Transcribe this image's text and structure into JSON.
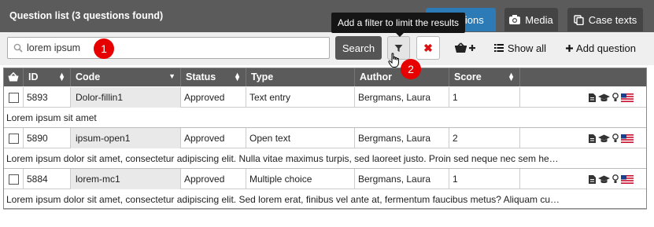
{
  "header": {
    "title": "Question list  (3 questions found)",
    "tabs": [
      {
        "label": "Questions",
        "icon": "list-icon"
      },
      {
        "label": "Media",
        "icon": "camera-icon"
      },
      {
        "label": "Case texts",
        "icon": "copy-icon"
      }
    ],
    "tooltip": "Add a filter to limit the results"
  },
  "toolbar": {
    "search_value": "lorem ipsum",
    "search_label": "Search",
    "clear_label": "✖",
    "basket_label": "🧺+",
    "show_all_label": "Show all",
    "add_question_label": "Add question"
  },
  "callouts": [
    "1",
    "2"
  ],
  "table": {
    "headers": [
      "ID",
      "Code",
      "Status",
      "Type",
      "Author",
      "Score"
    ],
    "rows": [
      {
        "id": "5893",
        "code": "Dolor-fillin1",
        "status": "Approved",
        "type": "Text entry",
        "author": "Bergmans, Laura",
        "score": "1",
        "description": "Lorem ipsum sit amet"
      },
      {
        "id": "5890",
        "code": "ipsum-open1",
        "status": "Approved",
        "type": "Open text",
        "author": "Bergmans, Laura",
        "score": "2",
        "description": "Lorem ipsum dolor sit amet, consectetur adipiscing elit. Nulla vitae maximus turpis, sed laoreet justo. Proin sed neque nec sem he…"
      },
      {
        "id": "5884",
        "code": "lorem-mc1",
        "status": "Approved",
        "type": "Multiple choice",
        "author": "Bergmans, Laura",
        "score": "1",
        "description": "Lorem ipsum dolor sit amet, consectetur adipiscing elit. Sed lorem erat, finibus vel ante at, fermentum faucibus metus? Aliquam cu…"
      }
    ]
  },
  "colors": {
    "header_bg": "#5b5b5b",
    "active_tab": "#2c7bb6",
    "callout": "#e60000"
  }
}
